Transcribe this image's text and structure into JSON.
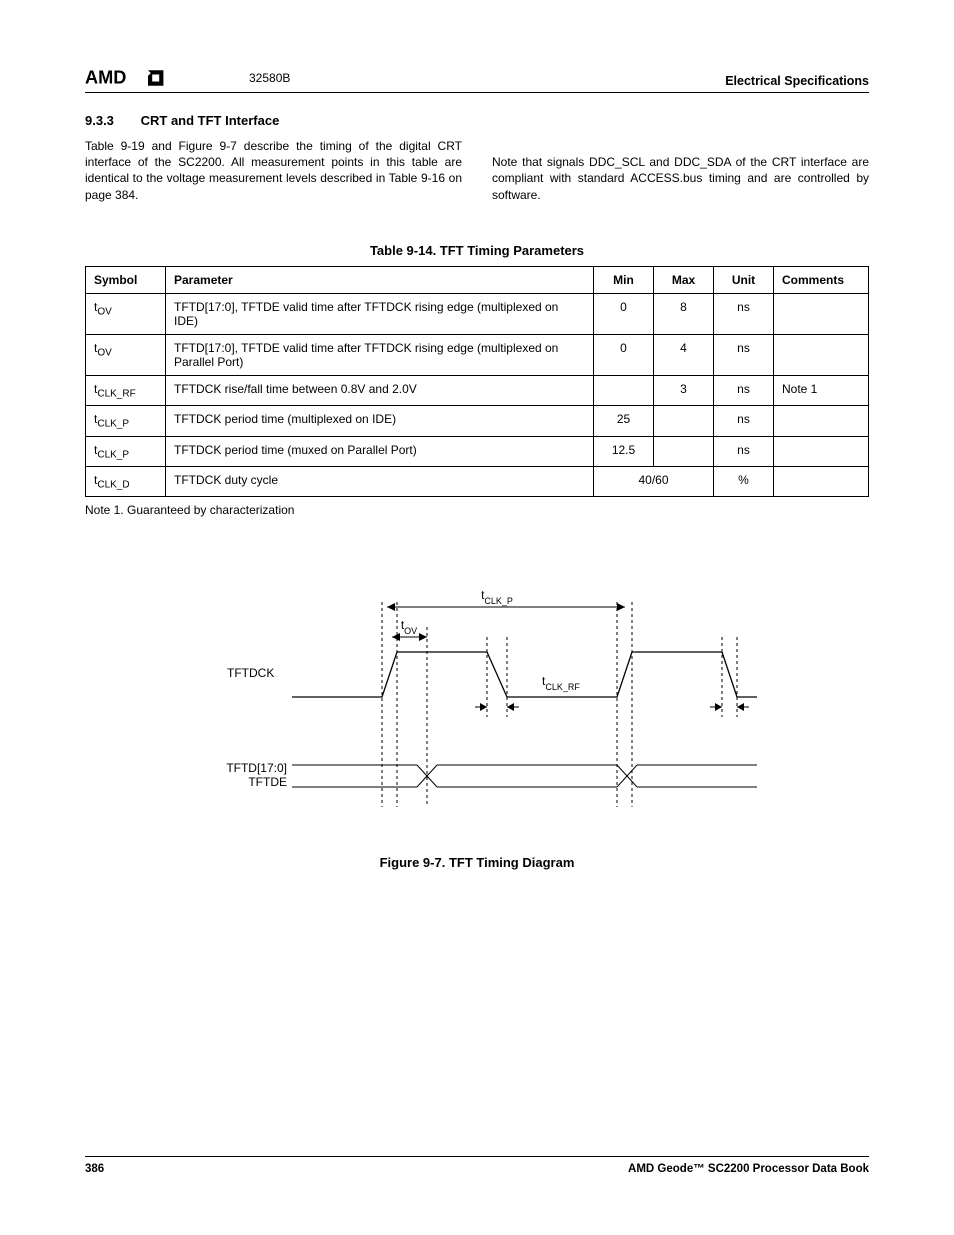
{
  "header": {
    "logo_text": "AMD",
    "doc_code": "32580B",
    "right": "Electrical Specifications"
  },
  "section": {
    "number": "9.3.3",
    "title": "CRT and TFT Interface",
    "para_left": "Table 9-19 and Figure 9-7 describe the timing of the digital CRT interface of the SC2200. All measurement points in this table are identical to the voltage measurement levels described in Table 9-16 on page 384.",
    "para_right": "Note that signals DDC_SCL and DDC_SDA of the CRT interface are compliant with standard ACCESS.bus timing and are controlled by software."
  },
  "table": {
    "caption": "Table 9-14.  TFT Timing Parameters",
    "headers": [
      "Symbol",
      "Parameter",
      "Min",
      "Max",
      "Unit",
      "Comments"
    ],
    "rows": [
      {
        "sym_base": "t",
        "sym_sub": "OV",
        "param": "TFTD[17:0], TFTDE valid time after TFTDCK rising edge (multiplexed on IDE)",
        "min": "0",
        "max": "8",
        "unit": "ns",
        "comments": ""
      },
      {
        "sym_base": "t",
        "sym_sub": "OV",
        "param": "TFTD[17:0], TFTDE valid time after TFTDCK rising edge (multiplexed on Parallel Port)",
        "min": "0",
        "max": "4",
        "unit": "ns",
        "comments": ""
      },
      {
        "sym_base": "t",
        "sym_sub": "CLK_RF",
        "param": "TFTDCK rise/fall time between 0.8V and 2.0V",
        "min": "",
        "max": "3",
        "unit": "ns",
        "comments": "Note 1"
      },
      {
        "sym_base": "t",
        "sym_sub": "CLK_P",
        "param": "TFTDCK period time (multiplexed on IDE)",
        "min": "25",
        "max": "",
        "unit": "ns",
        "comments": ""
      },
      {
        "sym_base": "t",
        "sym_sub": "CLK_P",
        "param": "TFTDCK period time (muxed on Parallel Port)",
        "min": "12.5",
        "max": "",
        "unit": "ns",
        "comments": ""
      },
      {
        "sym_base": "t",
        "sym_sub": "CLK_D",
        "param": "TFTDCK duty cycle",
        "min_max_merged": "40/60",
        "unit": "%",
        "comments": ""
      }
    ],
    "note": "Note 1.   Guaranteed by characterization"
  },
  "figure": {
    "caption": "Figure 9-7.  TFT Timing Diagram",
    "labels": {
      "tclkp": "CLK_P",
      "tov": "OV",
      "tclkrf": "CLK_RF",
      "tftdck": "TFTDCK",
      "tftd": "TFTD[17:0]",
      "tftde": "TFTDE"
    }
  },
  "footer": {
    "page": "386",
    "right": "AMD Geode™ SC2200  Processor Data Book"
  }
}
